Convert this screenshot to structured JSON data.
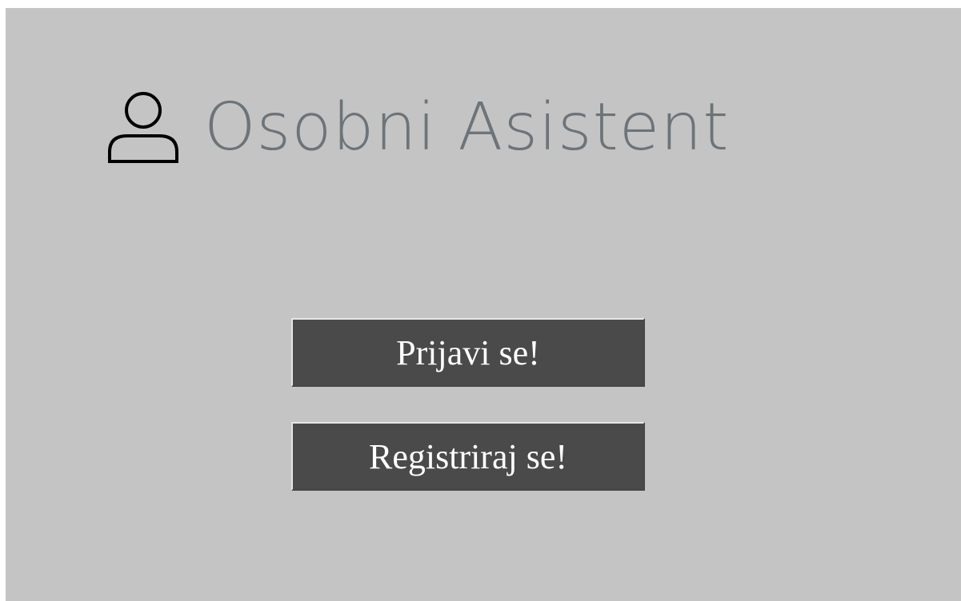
{
  "header": {
    "icon": "user-icon",
    "title": "Osobni Asistent"
  },
  "actions": {
    "login_label": "Prijavi se!",
    "register_label": "Registriraj se!"
  },
  "colors": {
    "background": "#c4c4c4",
    "title": "#6c7479",
    "button_bg": "#4a4a4a",
    "button_text": "#ffffff"
  }
}
